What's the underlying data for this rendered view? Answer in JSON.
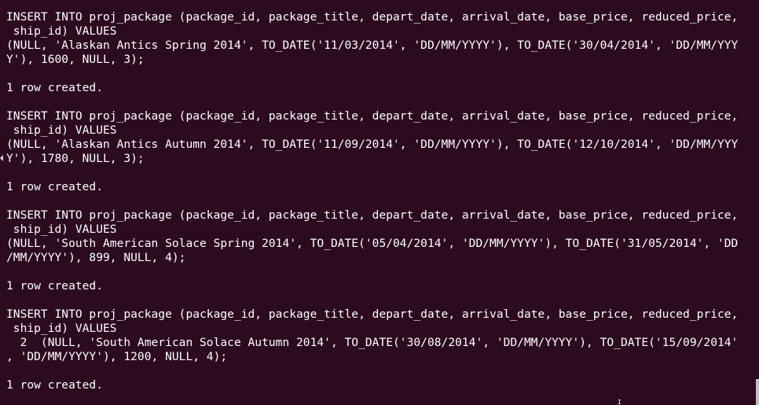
{
  "terminal": {
    "lines": [
      "INSERT INTO proj_package (package_id, package_title, depart_date, arrival_date, base_price, reduced_price,",
      " ship_id) VALUES",
      "(NULL, 'Alaskan Antics Spring 2014', TO_DATE('11/03/2014', 'DD/MM/YYYY'), TO_DATE('30/04/2014', 'DD/MM/YYY",
      "Y'), 1600, NULL, 3);",
      "",
      "1 row created.",
      "",
      "INSERT INTO proj_package (package_id, package_title, depart_date, arrival_date, base_price, reduced_price,",
      " ship_id) VALUES",
      "(NULL, 'Alaskan Antics Autumn 2014', TO_DATE('11/09/2014', 'DD/MM/YYYY'), TO_DATE('12/10/2014', 'DD/MM/YYY",
      "Y'), 1780, NULL, 3);",
      "",
      "1 row created.",
      "",
      "INSERT INTO proj_package (package_id, package_title, depart_date, arrival_date, base_price, reduced_price,",
      " ship_id) VALUES",
      "(NULL, 'South American Solace Spring 2014', TO_DATE('05/04/2014', 'DD/MM/YYYY'), TO_DATE('31/05/2014', 'DD",
      "/MM/YYYY'), 899, NULL, 4);",
      "",
      "1 row created.",
      "",
      "INSERT INTO proj_package (package_id, package_title, depart_date, arrival_date, base_price, reduced_price,",
      " ship_id) VALUES",
      "  2  (NULL, 'South American Solace Autumn 2014', TO_DATE('30/08/2014', 'DD/MM/YYYY'), TO_DATE('15/09/2014'",
      ", 'DD/MM/YYYY'), 1200, NULL, 4);",
      "",
      "1 row created."
    ]
  },
  "icons": {
    "wrap_marker": "line-wrap-arrow-icon",
    "cursor": "mouse-cursor-icon"
  },
  "colors": {
    "background": "#2c0a20",
    "text": "#ffffff"
  }
}
